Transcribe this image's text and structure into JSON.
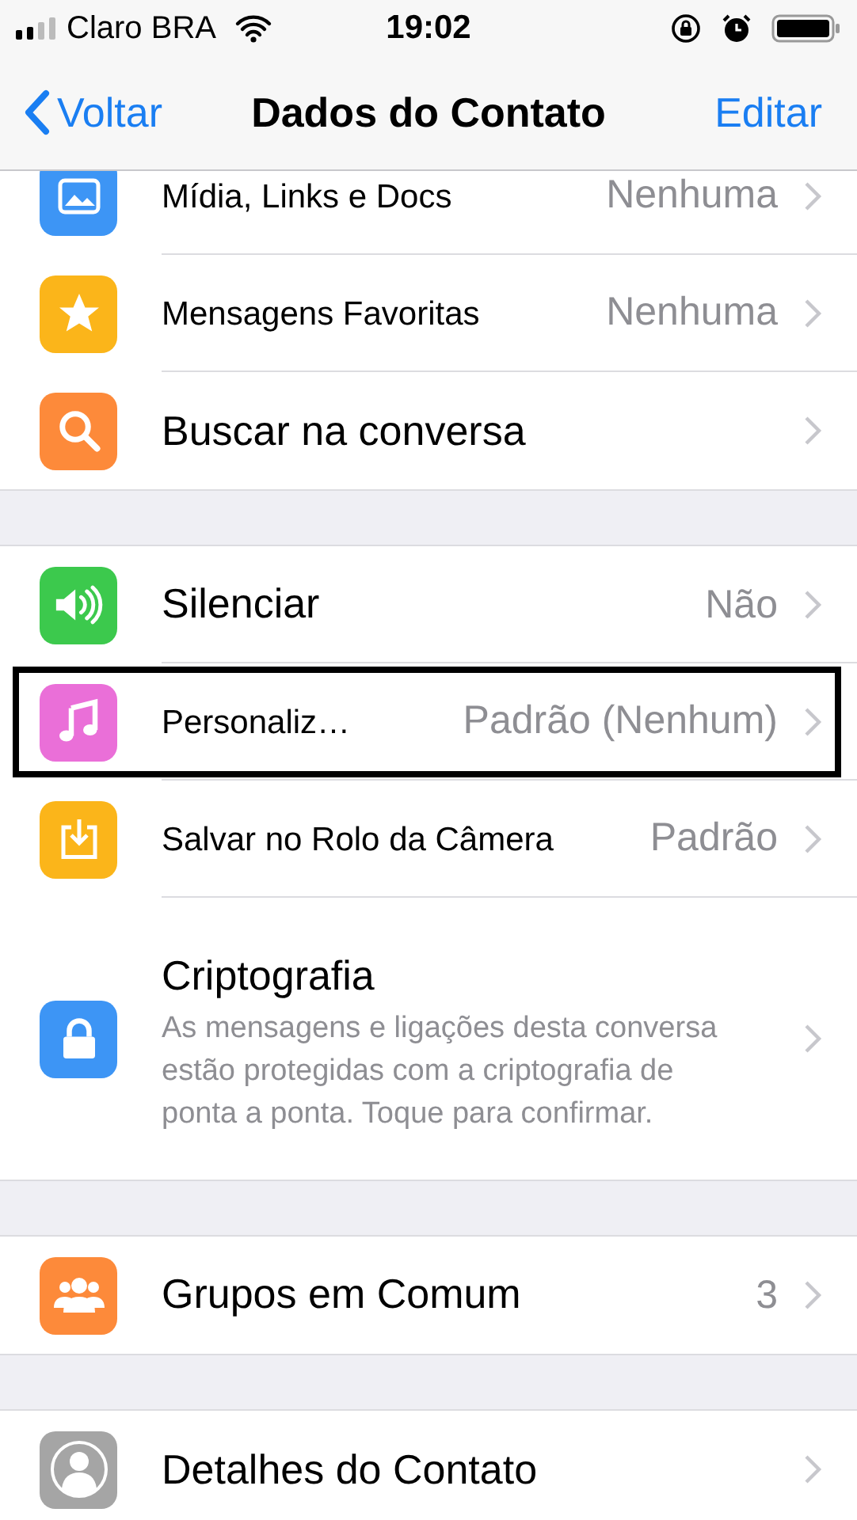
{
  "status_bar": {
    "carrier": "Claro BRA",
    "time": "19:02"
  },
  "nav": {
    "back": "Voltar",
    "title": "Dados do Contato",
    "action": "Editar"
  },
  "sections": [
    {
      "rows": [
        {
          "kind": "media",
          "color": "#3d95f5",
          "title": "Mídia, Links e Docs",
          "value": "Nenhuma",
          "highlighted": false
        },
        {
          "kind": "star",
          "color": "#fbb51a",
          "title": "Mensagens Favoritas",
          "value": "Nenhuma",
          "highlighted": false
        },
        {
          "kind": "search",
          "color": "#fd8a3a",
          "title": "Buscar na conversa",
          "highlighted": false
        }
      ]
    },
    {
      "rows": [
        {
          "kind": "speaker",
          "color": "#3cc94d",
          "title": "Silenciar",
          "value": "Não",
          "highlighted": false
        },
        {
          "kind": "music",
          "color": "#ea6fd8",
          "title": "Personaliz…",
          "value": "Padrão (Nenhum)",
          "highlighted": true
        },
        {
          "kind": "download",
          "color": "#fbb51a",
          "title": "Salvar no Rolo da Câmera",
          "value": "Padrão",
          "highlighted": false
        },
        {
          "kind": "lock",
          "color": "#3d95f5",
          "title": "Criptografia",
          "subtitle": "As mensagens e ligações desta conversa estão protegidas com a criptografia de ponta a ponta. Toque para confirmar.",
          "highlighted": false
        }
      ]
    },
    {
      "rows": [
        {
          "kind": "groups",
          "color": "#fd8a3a",
          "title": "Grupos em Comum",
          "value": "3",
          "highlighted": false
        }
      ]
    },
    {
      "rows": [
        {
          "kind": "contact",
          "color": "#a5a5a5",
          "title": "Detalhes do Contato",
          "highlighted": false
        }
      ]
    }
  ]
}
